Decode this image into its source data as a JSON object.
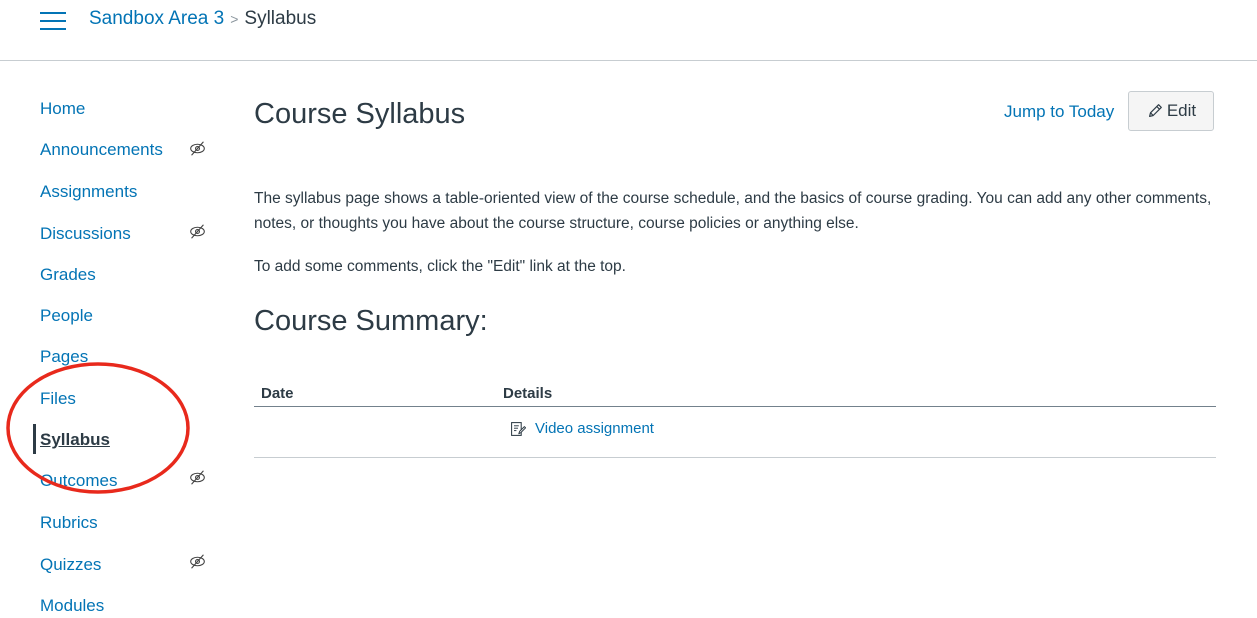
{
  "header": {
    "breadcrumb": {
      "course": "Sandbox Area 3",
      "separator": ">",
      "current": "Syllabus"
    }
  },
  "course_nav": {
    "items": [
      {
        "label": "Home",
        "hidden": false
      },
      {
        "label": "Announcements",
        "hidden": true
      },
      {
        "label": "Assignments",
        "hidden": false
      },
      {
        "label": "Discussions",
        "hidden": true
      },
      {
        "label": "Grades",
        "hidden": false
      },
      {
        "label": "People",
        "hidden": false
      },
      {
        "label": "Pages",
        "hidden": false
      },
      {
        "label": "Files",
        "hidden": false
      },
      {
        "label": "Syllabus",
        "hidden": false,
        "active": true
      },
      {
        "label": "Outcomes",
        "hidden": true
      },
      {
        "label": "Rubrics",
        "hidden": false
      },
      {
        "label": "Quizzes",
        "hidden": true
      },
      {
        "label": "Modules",
        "hidden": false
      }
    ],
    "annotation_ring_color": "#e8291c"
  },
  "main": {
    "title": "Course Syllabus",
    "jump_to_today": "Jump to Today",
    "edit_label": "Edit",
    "description": "The syllabus page shows a table-oriented view of the course schedule, and the basics of course grading. You can add any other comments, notes, or thoughts you have about the course structure, course policies or anything else.",
    "instruction": "To add some comments, click the \"Edit\" link at the top.",
    "summary_heading": "Course Summary:",
    "table": {
      "headers": [
        "Date",
        "Details"
      ],
      "rows": [
        {
          "date": "",
          "details": "Video assignment",
          "icon": "assignment-icon"
        }
      ]
    }
  },
  "colors": {
    "link": "#0374b5",
    "text": "#2d3b45",
    "rule": "#c7cdd1",
    "icon_gray": "#73818c"
  }
}
